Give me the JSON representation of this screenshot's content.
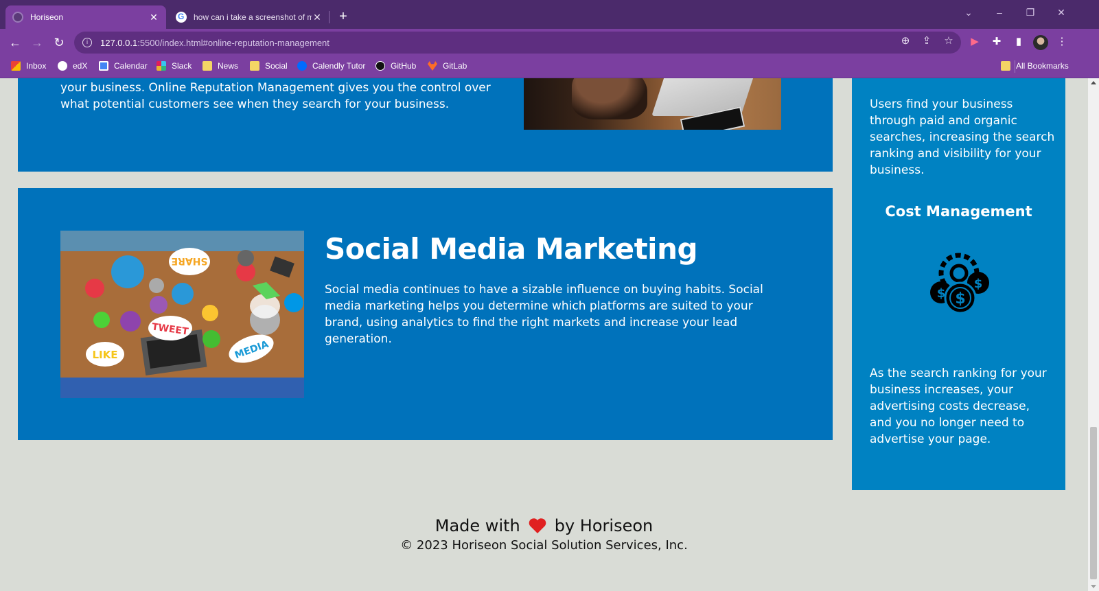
{
  "browser": {
    "tabs": [
      {
        "title": "Horiseon",
        "active": true
      },
      {
        "title": "how can i take a screenshot of m",
        "active": false
      }
    ],
    "url_host": "127.0.0.1",
    "url_rest": ":5500/index.html#online-reputation-management",
    "bookmarks": [
      {
        "label": "Inbox",
        "icon": "gmail-icon"
      },
      {
        "label": "edX",
        "icon": "edx-icon"
      },
      {
        "label": "Calendar",
        "icon": "calendar-icon"
      },
      {
        "label": "Slack",
        "icon": "slack-icon"
      },
      {
        "label": "News",
        "icon": "folder-icon"
      },
      {
        "label": "Social",
        "icon": "folder-icon"
      },
      {
        "label": "Calendly Tutor",
        "icon": "calendly-icon"
      },
      {
        "label": "GitHub",
        "icon": "github-icon"
      },
      {
        "label": "GitLab",
        "icon": "gitlab-icon"
      }
    ],
    "all_bookmarks": "All Bookmarks"
  },
  "reputation": {
    "text": "your business. Online Reputation Management gives you the control over what potential customers see when they search for your business."
  },
  "social": {
    "heading": "Social Media Marketing",
    "text": "Social media continues to have a sizable influence on buying habits. Social media marketing helps you determine which platforms are suited to your brand, using analytics to find the right markets and increase your lead generation.",
    "image_words": [
      "SHARE",
      "TWEET",
      "LIKE",
      "MEDIA"
    ]
  },
  "sidebar": {
    "seo_text": "Users find your business through paid and organic searches, increasing the search ranking and visibility for your business.",
    "cost_heading": "Cost Management",
    "cost_text": "As the search ranking for your business increases, your advertising costs decrease, and you no longer need to advertise your page."
  },
  "footer": {
    "made_with": "Made with",
    "by": "by Horiseon",
    "copyright": "© 2023 Horiseon Social Solution Services, Inc."
  },
  "colors": {
    "card_blue": "#0072bb",
    "sidebar_blue": "#0082c2",
    "page_bg": "#d9dcd6",
    "browser_purple": "#7b3fa0",
    "heart": "#e02020"
  }
}
